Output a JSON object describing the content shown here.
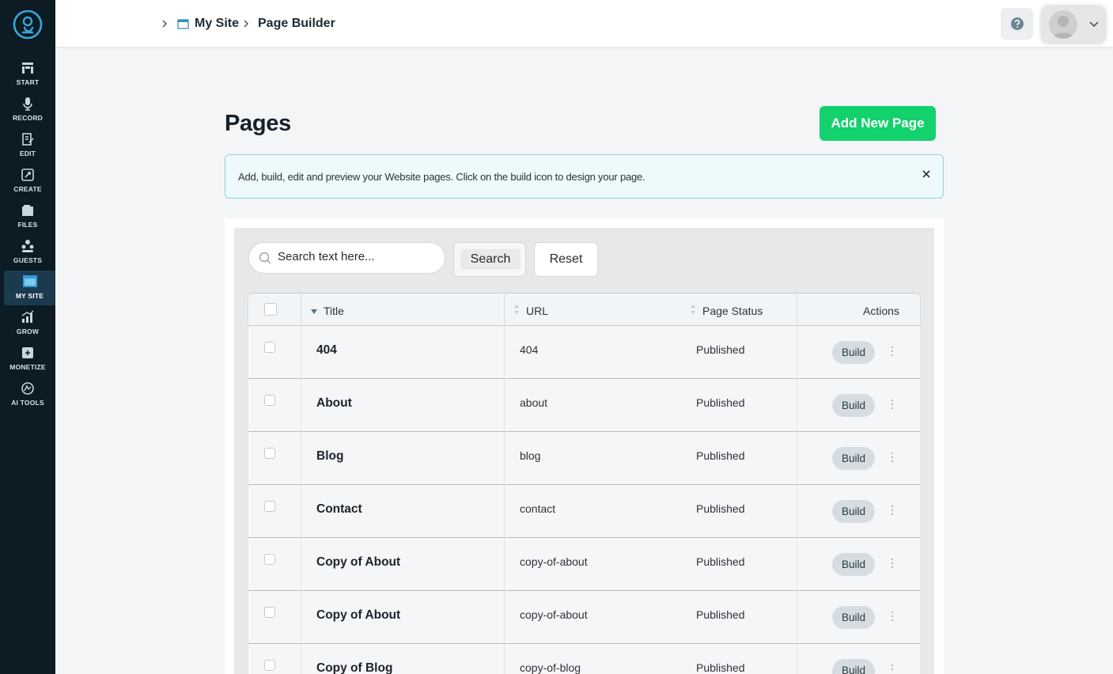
{
  "sidebar": {
    "items": [
      {
        "label": "START",
        "icon": "start-icon"
      },
      {
        "label": "RECORD",
        "icon": "microphone-icon"
      },
      {
        "label": "EDIT",
        "icon": "edit-icon"
      },
      {
        "label": "CREATE",
        "icon": "create-icon"
      },
      {
        "label": "FILES",
        "icon": "files-icon"
      },
      {
        "label": "GUESTS",
        "icon": "guests-icon"
      },
      {
        "label": "MY SITE",
        "icon": "my-site-icon",
        "active": true
      },
      {
        "label": "GROW",
        "icon": "grow-icon"
      },
      {
        "label": "MONETIZE",
        "icon": "monetize-icon"
      },
      {
        "label": "AI TOOLS",
        "icon": "ai-tools-icon"
      }
    ]
  },
  "breadcrumb": {
    "site": "My Site",
    "current": "Page Builder"
  },
  "main": {
    "title": "Pages",
    "add_button": "Add New Page",
    "info": "Add, build, edit and preview your Website pages. Click on the build icon to design your page."
  },
  "search": {
    "placeholder": "Search text here...",
    "search_label": "Search",
    "reset_label": "Reset"
  },
  "table": {
    "columns": {
      "title": "Title",
      "url": "URL",
      "status": "Page Status",
      "actions": "Actions"
    },
    "build_label": "Build",
    "rows": [
      {
        "title": "404",
        "url": "404",
        "status": "Published"
      },
      {
        "title": "About",
        "url": "about",
        "status": "Published"
      },
      {
        "title": "Blog",
        "url": "blog",
        "status": "Published"
      },
      {
        "title": "Contact",
        "url": "contact",
        "status": "Published"
      },
      {
        "title": "Copy of About",
        "url": "copy-of-about",
        "status": "Published"
      },
      {
        "title": "Copy of About",
        "url": "copy-of-about",
        "status": "Published"
      },
      {
        "title": "Copy of Blog",
        "url": "copy-of-blog",
        "status": "Published"
      }
    ]
  },
  "colors": {
    "accent_green": "#13d16d",
    "sidebar_bg": "#0c1b24",
    "info_border": "#8fd3e0"
  }
}
